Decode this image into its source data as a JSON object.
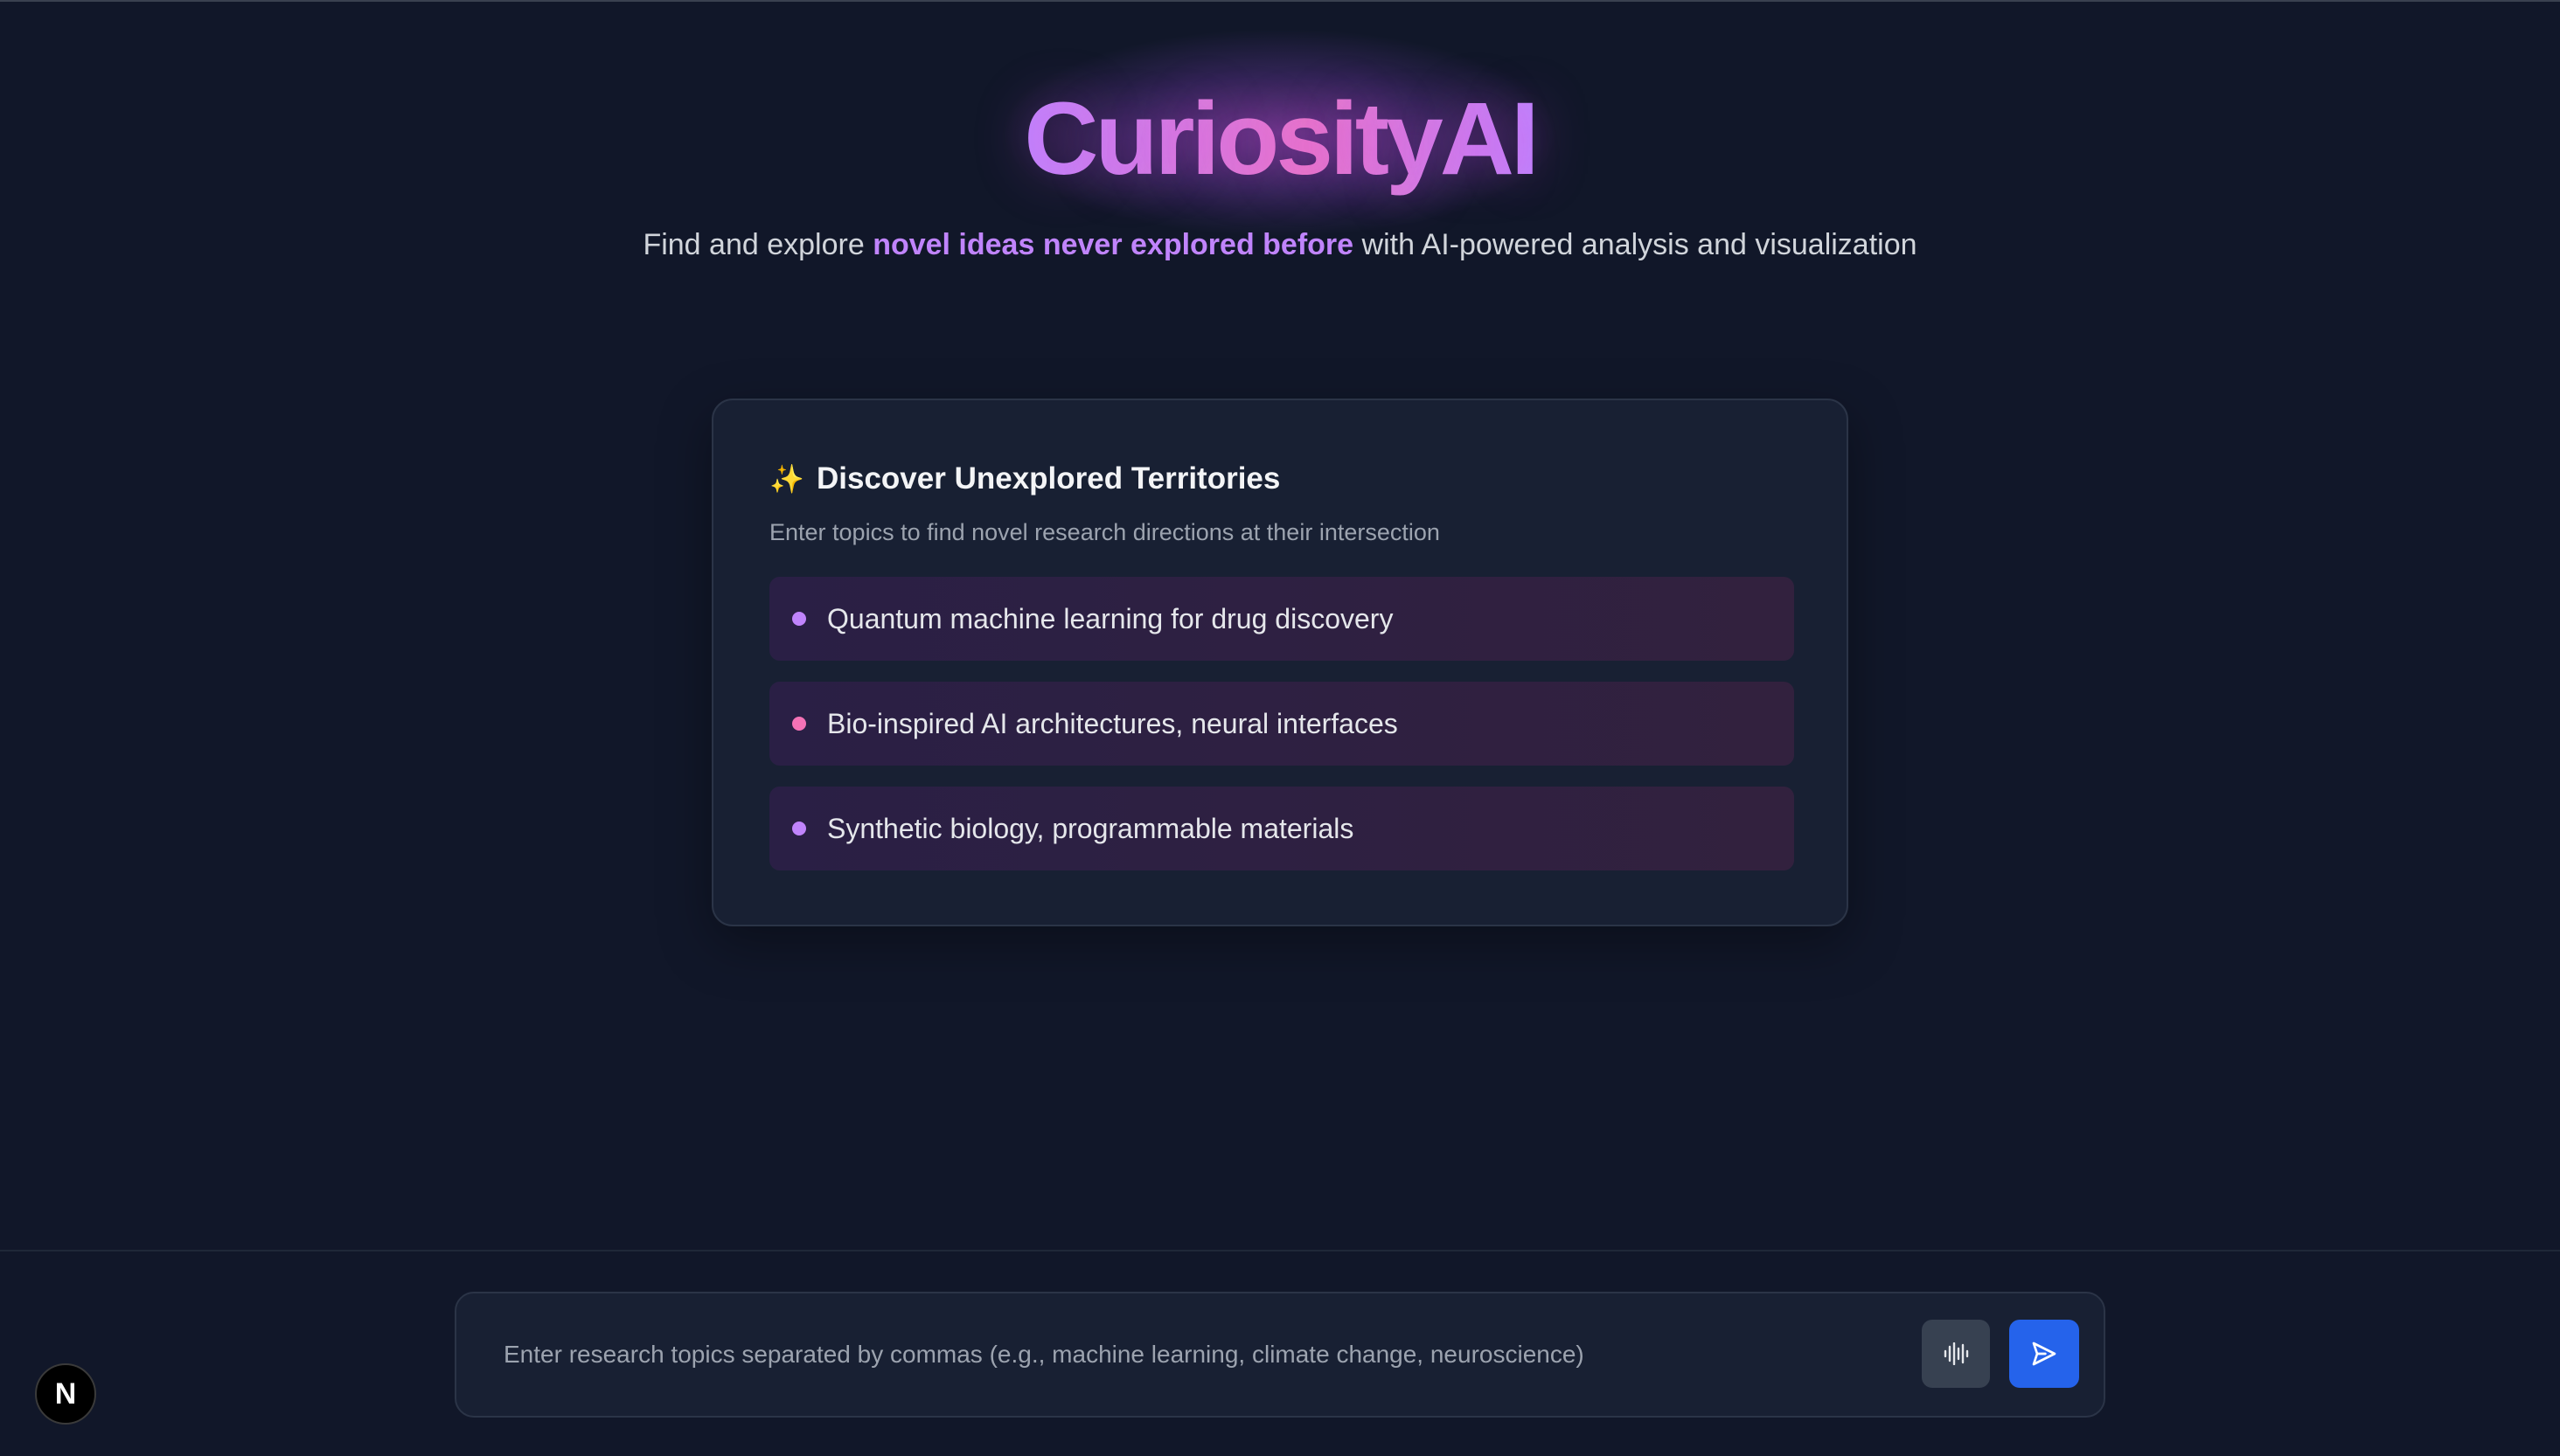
{
  "hero": {
    "brand": "CuriosityAI",
    "tagline_pre": "Find and explore ",
    "tagline_highlight": "novel ideas never explored before",
    "tagline_post": " with AI-powered analysis and visualization"
  },
  "card": {
    "icon": "sparkles-icon",
    "title": "Discover Unexplored Territories",
    "subtitle": "Enter topics to find novel research directions at their intersection",
    "topics": [
      {
        "label": "Quantum machine learning for drug discovery",
        "dot_color": "#c084fc"
      },
      {
        "label": "Bio-inspired AI architectures, neural interfaces",
        "dot_color": "#f472b6"
      },
      {
        "label": "Synthetic biology, programmable materials",
        "dot_color": "#c084fc"
      }
    ]
  },
  "composer": {
    "placeholder": "Enter research topics separated by commas (e.g., machine learning, climate change, neuroscience)",
    "value": "",
    "voice_icon": "audio-waveform-icon",
    "send_icon": "send-icon"
  },
  "badge": {
    "letter": "N"
  },
  "colors": {
    "background": "#111729",
    "accent_purple": "#c084fc",
    "accent_pink": "#e879c9",
    "send_button": "#2563eb"
  }
}
